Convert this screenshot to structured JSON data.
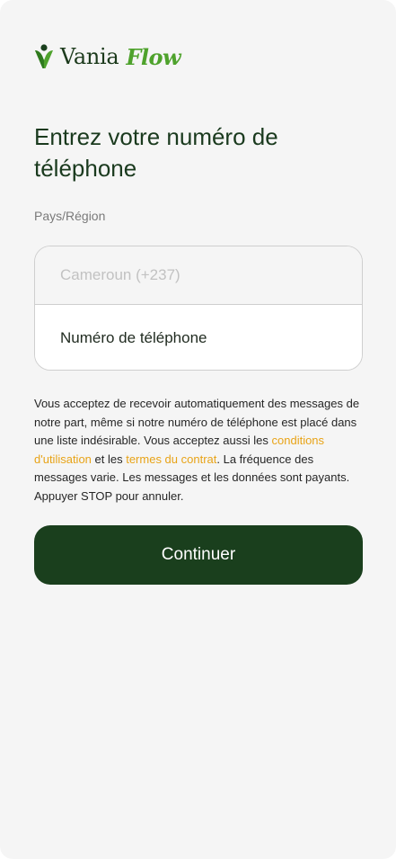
{
  "logo": {
    "word": "Vania",
    "accent": "Flow",
    "icon": "leaf-v-icon"
  },
  "heading": "Entrez votre numéro de téléphone",
  "country_label": "Pays/Région",
  "country_placeholder": "Cameroun (+237)",
  "phone_placeholder": "Numéro de téléphone",
  "consent": {
    "part1": "Vous acceptez de recevoir automatiquement des messages de notre part, même si notre numéro de téléphone est placé dans une liste indésirable. Vous acceptez aussi les ",
    "link1": "conditions d'utilisation",
    "part2": " et les ",
    "link2": "termes du contrat",
    "part3": ". La fréquence des messages varie. Les messages et les données sont payants. Appuyer STOP pour annuler."
  },
  "continue_label": "Continuer",
  "colors": {
    "brand_dark": "#1a3f1d",
    "brand_green": "#4ea22c",
    "link_orange": "#e8a317",
    "background": "#f5f5f5"
  }
}
